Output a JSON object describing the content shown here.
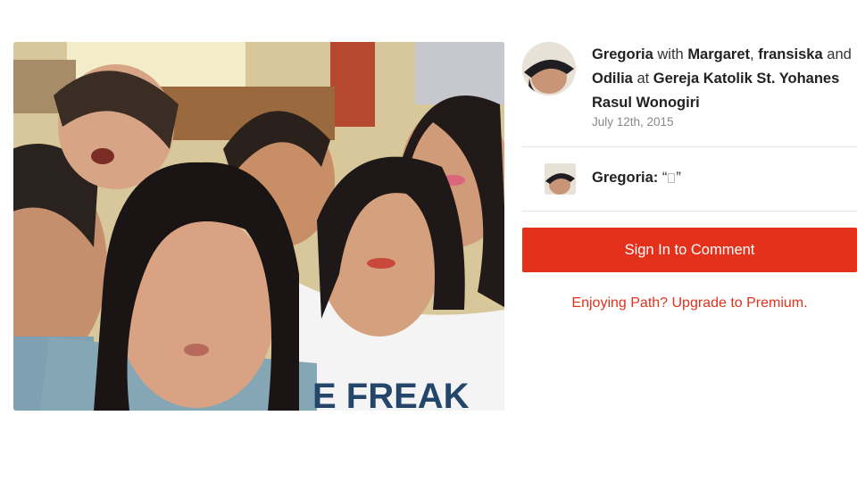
{
  "post": {
    "author": "Gregoria",
    "with_word": "with",
    "friends": [
      "Margaret",
      "fransiska",
      "Odilia"
    ],
    "sep_comma": ",",
    "and_word": "and",
    "at_word": "at",
    "location": "Gereja Katolik St. Yohanes Rasul Wonogiri",
    "date": "July 12th, 2015"
  },
  "comment": {
    "author": "Gregoria:",
    "open_quote": "“",
    "close_quote": "”"
  },
  "actions": {
    "sign_in_label": "Sign In to Comment",
    "upgrade_label": "Enjoying Path? Upgrade to Premium."
  },
  "colors": {
    "accent": "#e4311b",
    "date_text": "#888888",
    "divider": "#e6e6e6"
  },
  "photo": {
    "shirt_text": "E FREAK"
  }
}
